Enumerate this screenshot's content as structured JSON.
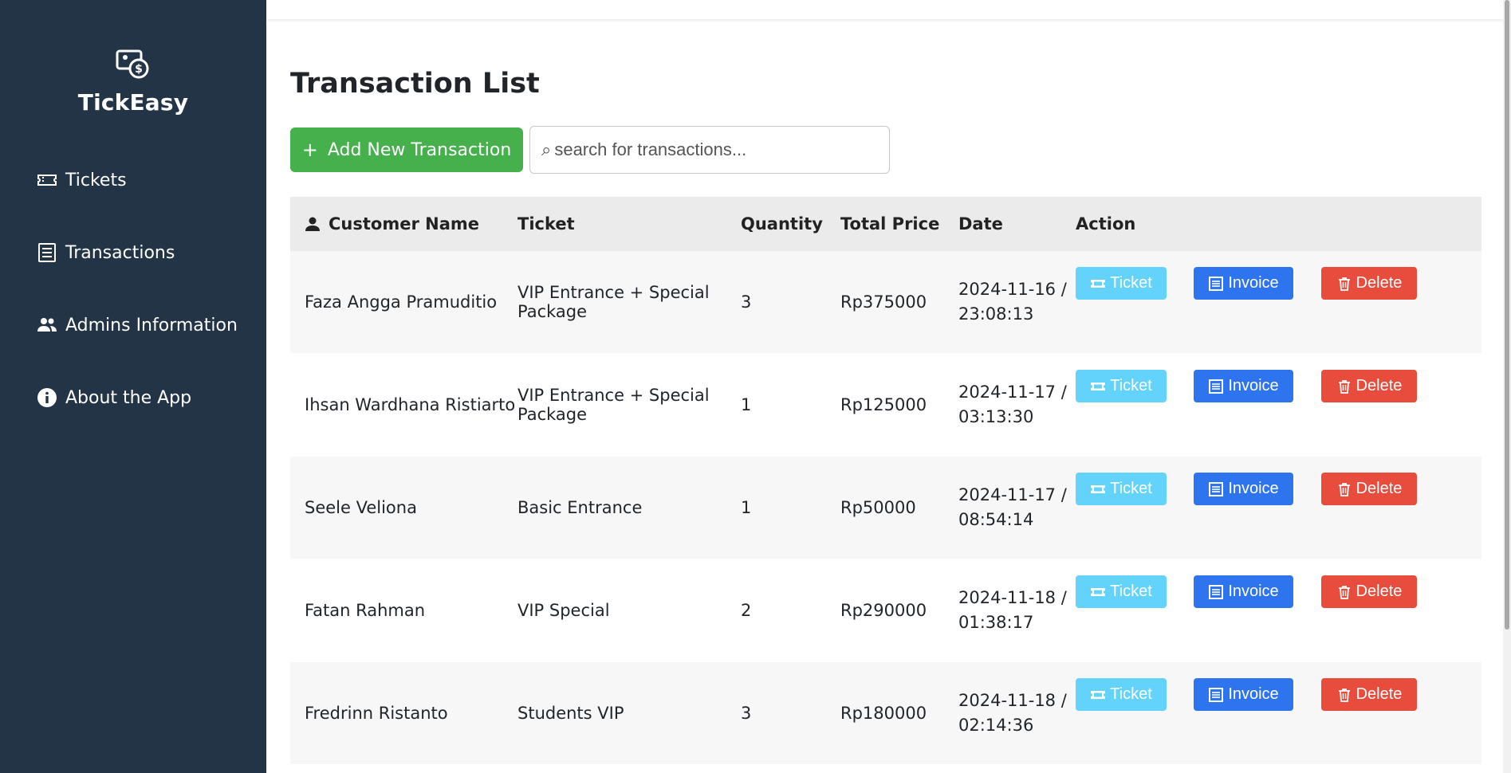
{
  "app": {
    "name": "TickEasy"
  },
  "sidebar": {
    "items": [
      {
        "label": "Tickets",
        "icon": "ticket-icon"
      },
      {
        "label": "Transactions",
        "icon": "receipt-icon"
      },
      {
        "label": "Admins Information",
        "icon": "users-icon"
      },
      {
        "label": "About the App",
        "icon": "info-icon"
      }
    ]
  },
  "main": {
    "title": "Transaction List",
    "add_button": {
      "label": "Add New Transaction",
      "icon": "plus-icon"
    },
    "search": {
      "placeholder": "search for transactions...",
      "value": "",
      "icon": "search-icon"
    }
  },
  "table": {
    "headers": {
      "name": "Customer Name",
      "ticket": "Ticket",
      "qty": "Quantity",
      "price": "Total Price",
      "date": "Date",
      "action": "Action"
    },
    "action_labels": {
      "ticket": "Ticket",
      "invoice": "Invoice",
      "delete": "Delete"
    },
    "rows": [
      {
        "name": "Faza Angga Pramuditio",
        "ticket": "VIP Entrance + Special Package",
        "qty": "3",
        "price": "Rp375000",
        "date": "2024-11-16 / 23:08:13"
      },
      {
        "name": "Ihsan Wardhana Ristiarto",
        "ticket": "VIP Entrance + Special Package",
        "qty": "1",
        "price": "Rp125000",
        "date": "2024-11-17 / 03:13:30"
      },
      {
        "name": "Seele Veliona",
        "ticket": "Basic Entrance",
        "qty": "1",
        "price": "Rp50000",
        "date": "2024-11-17 / 08:54:14"
      },
      {
        "name": "Fatan Rahman",
        "ticket": "VIP Special",
        "qty": "2",
        "price": "Rp290000",
        "date": "2024-11-18 / 01:38:17"
      },
      {
        "name": "Fredrinn Ristanto",
        "ticket": "Students VIP",
        "qty": "3",
        "price": "Rp180000",
        "date": "2024-11-18 / 02:14:36"
      }
    ]
  },
  "colors": {
    "sidebar_bg": "#233447",
    "add_button": "#46b04c",
    "ticket_button": "#63d3fb",
    "invoice_button": "#2e74ef",
    "delete_button": "#e74c3c"
  }
}
